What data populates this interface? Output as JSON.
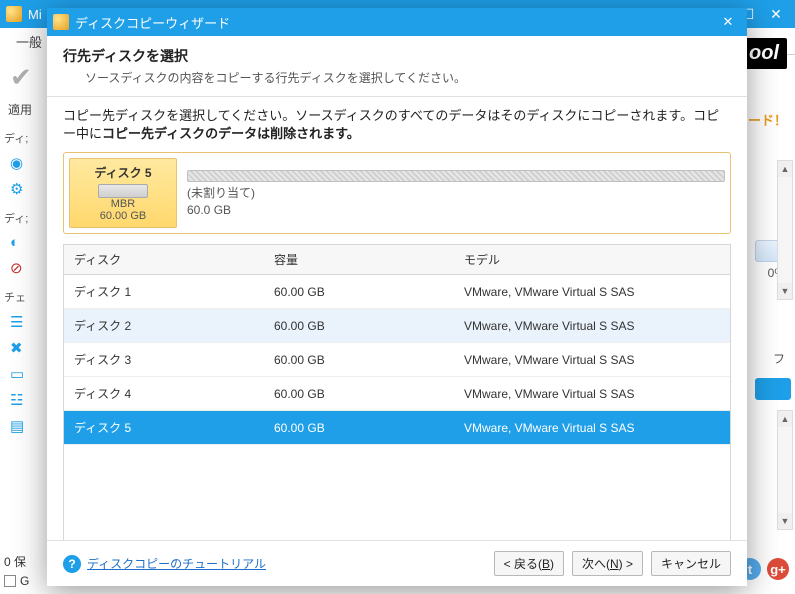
{
  "parent": {
    "title_fragment": "Mi",
    "tab_general": "一般",
    "apply_label": "適用",
    "brand_fragment": "ool",
    "right_badge": "ード！",
    "right_percent": "0%",
    "right_fu": "フ",
    "zero_ho": "0 保",
    "checkbox_g": "G",
    "sidebar": {
      "disk_prefix": "ディ;",
      "disk2_prefix": "ディ;",
      "check_prefix": "チェ"
    }
  },
  "dialog": {
    "title": "ディスクコピーウィザード",
    "heading": "行先ディスクを選択",
    "sub": "ソースディスクの内容をコピーする行先ディスクを選択してください。",
    "desc_prefix": "コピー先ディスクを選択してください。ソースディスクのすべてのデータはそのディスクにコピーされます。コピー中に",
    "desc_bold": "コピー先ディスクのデータは削除されます。",
    "preview": {
      "name": "ディスク 5",
      "scheme": "MBR",
      "size": "60.00 GB",
      "part_label": "(未割り当て)",
      "part_size": "60.0 GB"
    },
    "table": {
      "col_disk": "ディスク",
      "col_capacity": "容量",
      "col_model": "モデル",
      "rows": [
        {
          "disk": "ディスク 1",
          "capacity": "60.00 GB",
          "model": "VMware, VMware Virtual S SAS",
          "alt": false,
          "sel": false
        },
        {
          "disk": "ディスク 2",
          "capacity": "60.00 GB",
          "model": "VMware, VMware Virtual S SAS",
          "alt": true,
          "sel": false
        },
        {
          "disk": "ディスク 3",
          "capacity": "60.00 GB",
          "model": "VMware, VMware Virtual S SAS",
          "alt": false,
          "sel": false
        },
        {
          "disk": "ディスク 4",
          "capacity": "60.00 GB",
          "model": "VMware, VMware Virtual S SAS",
          "alt": false,
          "sel": false
        },
        {
          "disk": "ディスク 5",
          "capacity": "60.00 GB",
          "model": "VMware, VMware Virtual S SAS",
          "alt": false,
          "sel": true
        }
      ]
    },
    "footer": {
      "help_text": "ディスクコピーのチュートリアル",
      "back_pre": "< 戻る(",
      "back_key": "B",
      "back_post": ")",
      "next_pre": "次へ(",
      "next_key": "N",
      "next_post": ") >",
      "cancel": "キャンセル"
    }
  }
}
